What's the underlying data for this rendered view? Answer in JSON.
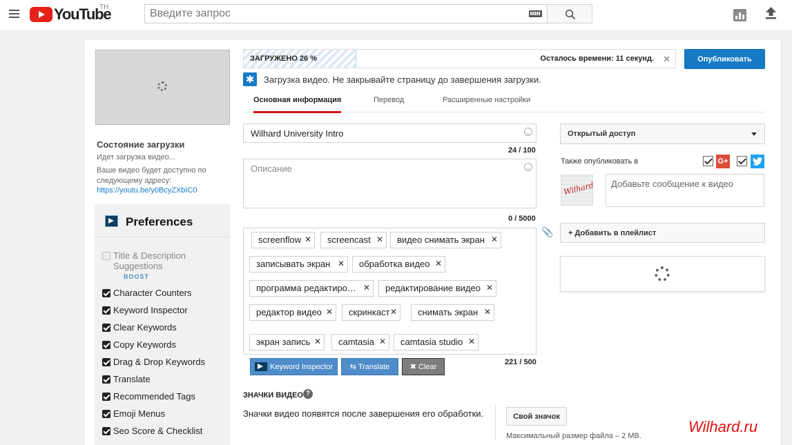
{
  "masthead": {
    "logo_text": "YouTube",
    "region": "TH",
    "search_placeholder": "Введите запрос",
    "icons": [
      "menu-icon",
      "keyboard-icon",
      "search-icon",
      "analytics-icon",
      "upload-icon"
    ]
  },
  "sidebar": {
    "status_title": "Состояние загрузки",
    "status_sub": "Идет загрузка видео...",
    "status_available": "Ваше видео будет доступно по следующему адресу:",
    "video_link": "https://youtu.be/y0BcyZXbIC0"
  },
  "preferences": {
    "title": "Preferences",
    "boost_label": "BOOST",
    "items": [
      {
        "label": "Title & Description Suggestions",
        "checked": false,
        "disabled": true
      },
      {
        "label": "Character Counters",
        "checked": true
      },
      {
        "label": "Keyword Inspector",
        "checked": true
      },
      {
        "label": "Clear Keywords",
        "checked": true
      },
      {
        "label": "Copy Keywords",
        "checked": true
      },
      {
        "label": "Drag & Drop Keywords",
        "checked": true
      },
      {
        "label": "Translate",
        "checked": true
      },
      {
        "label": "Recommended Tags",
        "checked": true
      },
      {
        "label": "Emoji Menus",
        "checked": true
      },
      {
        "label": "Seo Score & Checklist",
        "checked": true
      }
    ]
  },
  "upload": {
    "progress_label": "ЗАГРУЖЕНО 26 %",
    "progress_fraction": 0.26,
    "time_left": "Осталось времени: 11 секунд.",
    "close": "✕",
    "publish_label": "Опубликовать",
    "notice": "Загрузка видео. Не закрывайте страницу до завершения загрузки."
  },
  "tabs": [
    {
      "label": "Основная информация",
      "active": true
    },
    {
      "label": "Перевод",
      "active": false
    },
    {
      "label": "Расширенные настройки",
      "active": false
    }
  ],
  "form": {
    "title_value": "Wilhard University Intro",
    "title_counter": "24 / 100",
    "description_placeholder": "Описание",
    "description_counter": "0 / 5000",
    "tags_counter": "221 / 500",
    "tags": [
      "screenflow",
      "screencast",
      "видео снимать экран",
      "записывать экран",
      "обработка видео",
      "программа редактиро…",
      "редактирование видео",
      "редактор видео",
      "скринкаст",
      "снимать экран",
      "экран запись",
      "camtasia",
      "camtasia studio"
    ],
    "keyword_inspector_label": "Keyword Inspector",
    "translate_label": "Translate",
    "clear_label": "Clear"
  },
  "thumbnails": {
    "heading": "ЗНАЧКИ ВИДЕО",
    "help": "?",
    "text": "Значки видео появятся после завершения его обработки.",
    "own_button": "Свой значок",
    "max_size": "Максимальный размер файла – 2 МВ."
  },
  "right": {
    "privacy": "Открытый доступ",
    "also_publish": "Также опубликовать в",
    "gplus_label": "G+",
    "avatar_sig": "Wilhard",
    "share_placeholder": "Добавьте сообщение к видео",
    "playlist": "+ Добавить в плейлист"
  },
  "watermark": "Wilhard.ru",
  "colors": {
    "accent": "#167ac6",
    "brand_red": "#e62117",
    "tab_underline": "#cc181e",
    "watermark": "#e01010"
  }
}
